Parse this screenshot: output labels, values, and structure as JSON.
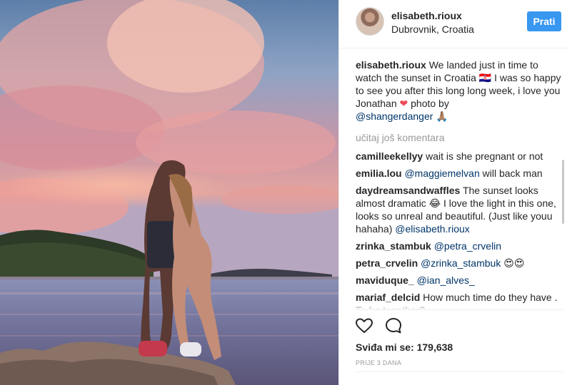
{
  "post": {
    "username": "elisabeth.rioux",
    "location": "Dubrovnik, Croatia",
    "follow_label": "Prati"
  },
  "caption": {
    "username": "elisabeth.rioux",
    "text_part1": "We landed just in time to watch the sunset in Croatia ",
    "emoji_flag": "🇭🇷",
    "text_part2": " I was so happy to see you after this long long week, i love you Jonathan ",
    "emoji_heart": "❤",
    "text_part3": " photo by ",
    "mention": "@shangerdanger",
    "emoji_end": "🙏🏽"
  },
  "load_more_label": "učitaj još komentara",
  "comments": [
    {
      "username": "camilleekellyy",
      "text": "wait is she pregnant or not"
    },
    {
      "username": "emilia.lou",
      "mention": "@maggiemelvan",
      "text": " will back man"
    },
    {
      "username": "daydreamsandwaffles",
      "text": "The sunset looks almost dramatic 😂 I love the light in this one, looks so unreal and beautiful. (Just like youu hahaha) ",
      "mention_end": "@elisabeth.rioux"
    },
    {
      "username": "zrinka_stambuk",
      "mention": "@petra_crvelin",
      "text": ""
    },
    {
      "username": "petra_crvelin",
      "mention": "@zrinka_stambuk",
      "text": " 😍😍"
    },
    {
      "username": "maviduque_",
      "mention": "@ian_alves_",
      "text": ""
    },
    {
      "username": "mariaf_delcid",
      "text": "How much time do they have . To be together?"
    }
  ],
  "likes": {
    "label": "Sviđa mi se:",
    "count": "179,638"
  },
  "time_ago": "PRIJE 3 DANA",
  "icons": {
    "like": "heart-icon",
    "comment": "comment-icon"
  }
}
